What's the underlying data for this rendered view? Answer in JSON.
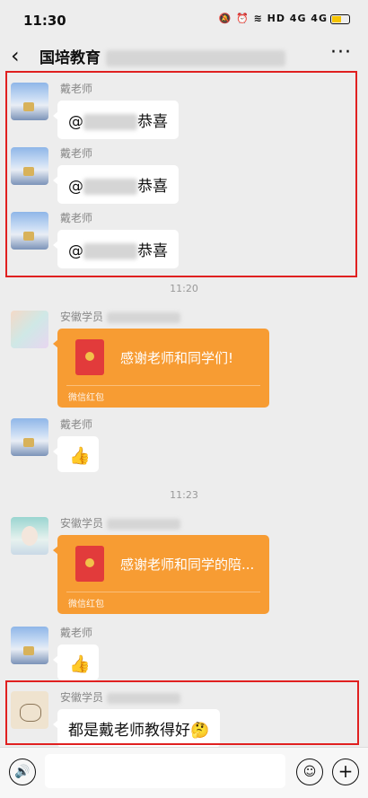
{
  "status": {
    "time": "11:30",
    "icons": "🔕 ⏰ ≋ HD 4G 4G"
  },
  "header": {
    "back": "‹",
    "title": "国培教育",
    "more": "···"
  },
  "messages": [
    {
      "sender": "戴老师",
      "at": "@",
      "text": "恭喜"
    },
    {
      "sender": "戴老师",
      "at": "@",
      "text": "恭喜"
    },
    {
      "sender": "戴老师",
      "at": "@",
      "text": "恭喜"
    },
    {
      "sender": "安徽学员",
      "text": "感谢老师和同学们!",
      "label": "微信红包"
    },
    {
      "sender": "戴老师",
      "text": "👍"
    },
    {
      "sender": "安徽学员",
      "text": "感谢老师和同学的陪...",
      "label": "微信红包"
    },
    {
      "sender": "戴老师",
      "text": "👍"
    },
    {
      "sender": "安徽学员",
      "text": "都是戴老师教得好🤔"
    }
  ],
  "timestamps": [
    "11:20",
    "11:23"
  ],
  "input": {
    "voice_icon": "🔊",
    "emoji_icon": "☺",
    "plus_icon": "+"
  }
}
